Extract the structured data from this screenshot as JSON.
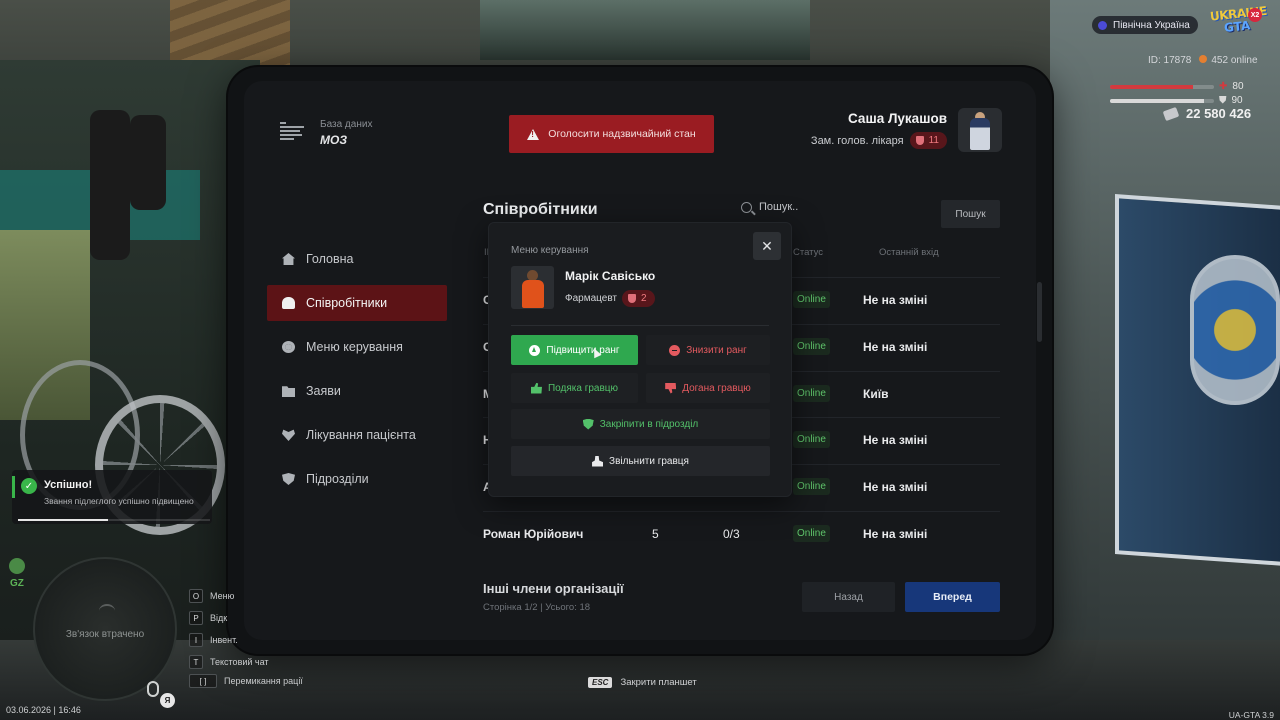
{
  "hud": {
    "server_name": "Північна Україна",
    "logo_line1": "UKRAINE",
    "logo_line2": "GTA",
    "logo_badge": "X2",
    "player_id": "ID: 17878",
    "online": "452 online",
    "health": "80",
    "health_level": 0.8,
    "armor": "90",
    "armor_level": 0.9,
    "money": "22 580 426",
    "colors": {
      "health": "#d33a3f",
      "armor": "#d9d9d9"
    }
  },
  "tablet": {
    "brand_mark_label": "Міністерство охорони здоров'я України",
    "brand_sub": "База даних",
    "brand_title": "МОЗ",
    "emergency_label": "Оголосити надзвичайний стан",
    "user": {
      "name": "Саша Лукашов",
      "role": "Зам. голов. лікаря",
      "rank": "11"
    },
    "sidebar": [
      {
        "label": "Головна",
        "icon": "home-icon"
      },
      {
        "label": "Співробітники",
        "icon": "users-icon",
        "active": true
      },
      {
        "label": "Меню керування",
        "icon": "gear-icon"
      },
      {
        "label": "Заяви",
        "icon": "folder-icon"
      },
      {
        "label": "Лікування пацієнта",
        "icon": "heart-icon"
      },
      {
        "label": "Підрозділи",
        "icon": "shield-icon"
      }
    ],
    "section_title": "Співробітники",
    "search_placeholder": "Пошук..",
    "search_button": "Пошук",
    "columns": {
      "id": "ID",
      "status": "Статус",
      "last_login": "Останній вхід"
    },
    "rows": [
      {
        "name": "С",
        "status": "Online",
        "last": "Не на зміні"
      },
      {
        "name": "С",
        "status": "Online",
        "last": "Не на зміні"
      },
      {
        "name": "М",
        "status": "Online",
        "last": "Київ"
      },
      {
        "name": "Н",
        "status": "Online",
        "last": "Не на зміні"
      },
      {
        "name": "А",
        "status": "Online",
        "last": "Не на зміні"
      },
      {
        "name": "Роман Юрійович",
        "rank": "5",
        "warnings": "0/3",
        "status": "Online",
        "last": "Не на зміні"
      }
    ],
    "others_title": "Інші члени організації",
    "pager_info": "Сторінка 1/2 | Усього: 18",
    "back_label": "Назад",
    "forward_label": "Вперед",
    "colors": {
      "accent_red": "#9a1c22",
      "online_green": "#5fc46b",
      "forward_blue": "#17377a"
    }
  },
  "modal": {
    "title": "Меню керування",
    "close_symbol": "✕",
    "player_name": "Марік Савісько",
    "player_role": "Фармацевт",
    "player_rank": "2",
    "actions": {
      "promote": "Підвищити ранг",
      "demote": "Знизити ранг",
      "thanks": "Подяка гравцю",
      "reprimand": "Догана гравцю",
      "assign": "Закріпити в підрозділ",
      "fire": "Звільнити гравця"
    },
    "colors": {
      "promote": "#2fa84f",
      "positive": "#53c16a",
      "negative": "#e35a5f"
    }
  },
  "notification": {
    "title": "Успішно!",
    "text": "Звання підлеглого успішно підвищено",
    "progress": 0.47,
    "check_symbol": "✓"
  },
  "minimap": {
    "zone_label": "GZ",
    "lost_connection": "Зв'язок втрачено",
    "lang": "Я"
  },
  "hints": [
    {
      "key": "O",
      "label": "Меню"
    },
    {
      "key": "P",
      "label": "Відк"
    },
    {
      "key": "I",
      "label": "Інвент."
    },
    {
      "key": "T",
      "label": "Текстовий чат"
    },
    {
      "key": "[ ]",
      "label": "Перемикання рації"
    }
  ],
  "esc_hint": {
    "key": "ESC",
    "label": "Закрити планшет"
  },
  "datetime": "03.06.2026 | 16:46",
  "version": "UA-GTA 3.9"
}
